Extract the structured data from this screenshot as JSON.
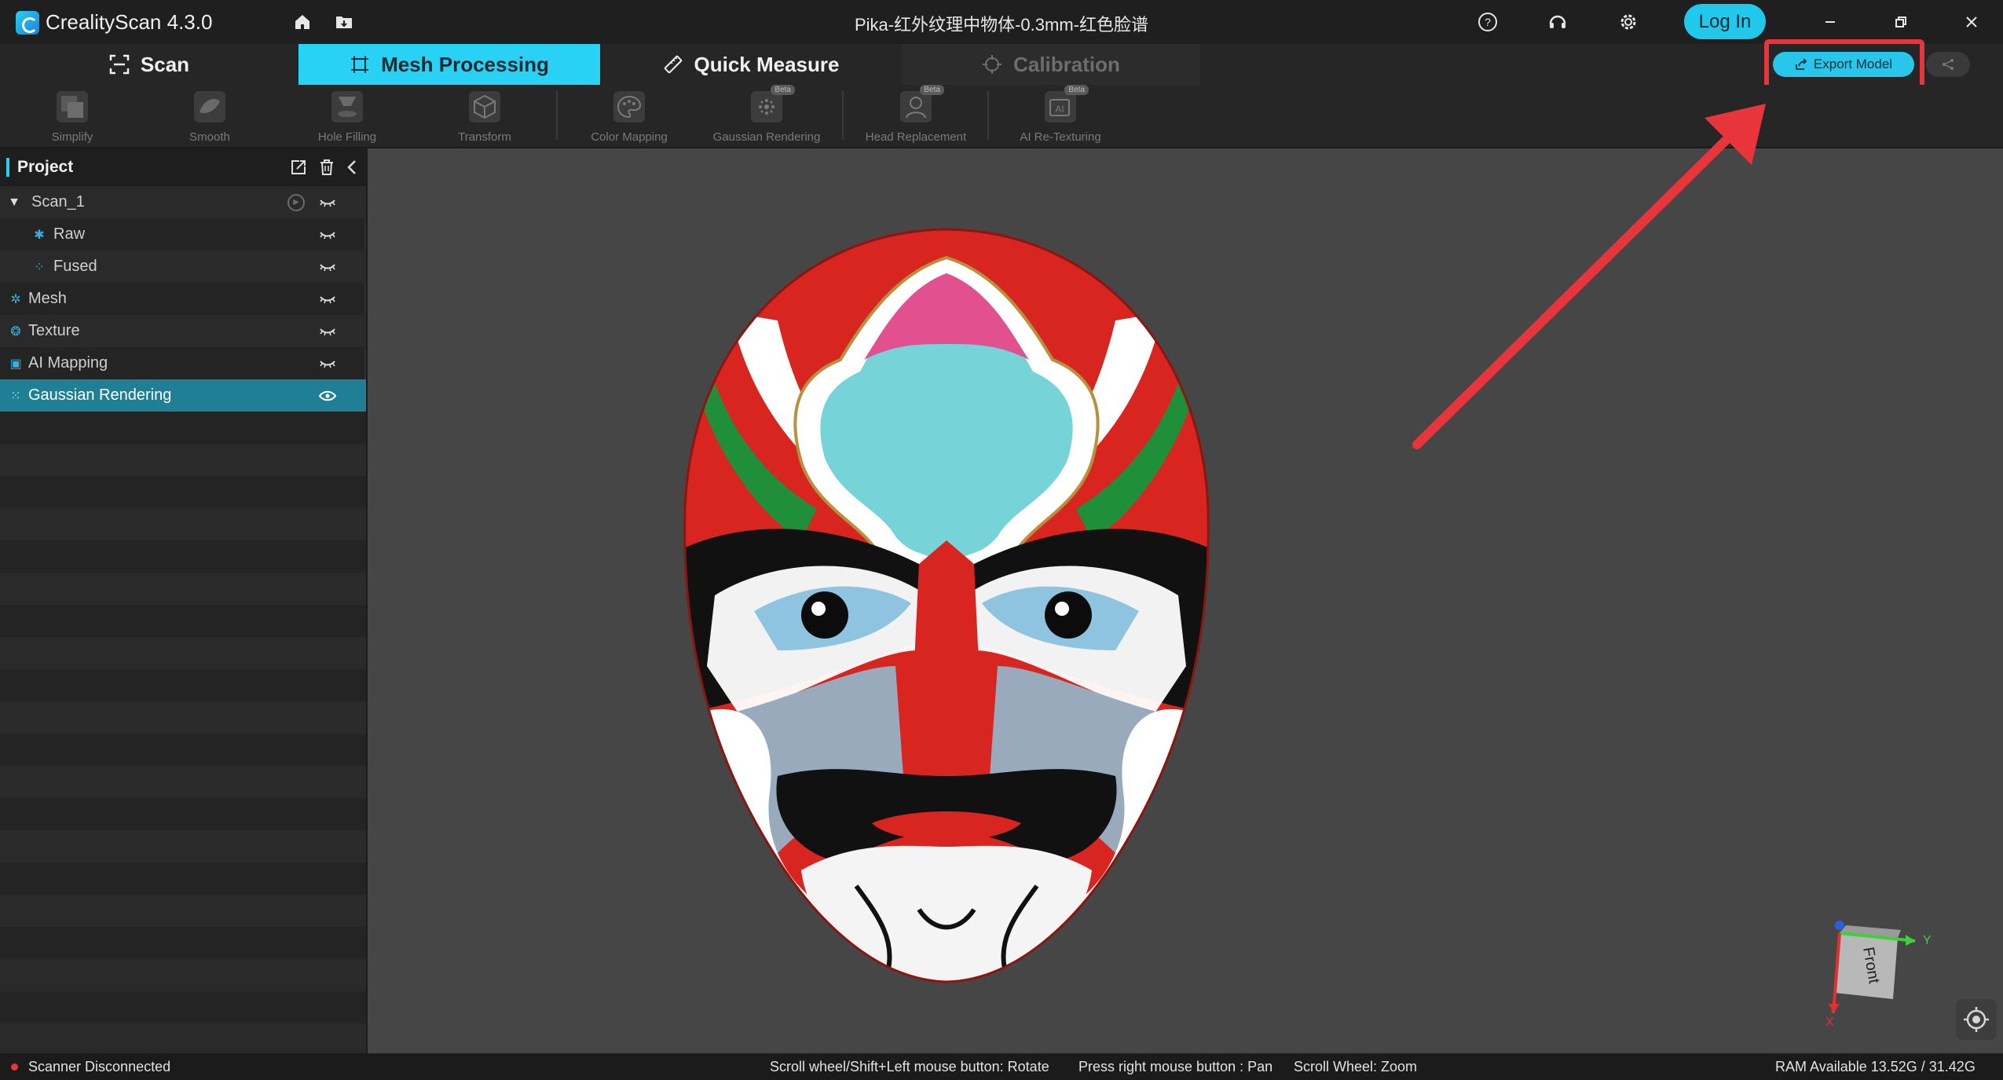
{
  "app": {
    "name": "CrealityScan 4.3.0",
    "document_title": "Pika-红外纹理中物体-0.3mm-红色脸谱"
  },
  "titlebar": {
    "login_label": "Log In",
    "icons": [
      "home-icon",
      "folder-icon",
      "help-icon",
      "support-headset-icon",
      "settings-icon",
      "minimize-icon",
      "restore-icon",
      "close-icon"
    ]
  },
  "modes": [
    {
      "label": "Scan",
      "icon": "scan-icon",
      "state": "normal"
    },
    {
      "label": "Mesh Processing",
      "icon": "mesh-processing-icon",
      "state": "active"
    },
    {
      "label": "Quick Measure",
      "icon": "ruler-icon",
      "state": "normal"
    },
    {
      "label": "Calibration",
      "icon": "crosshair-icon",
      "state": "disabled"
    }
  ],
  "export": {
    "label": "Export Model",
    "icon": "export-icon",
    "accent": "#27c6ea"
  },
  "tools": [
    {
      "label": "Simplify",
      "icon": "simplify-icon",
      "beta": false
    },
    {
      "label": "Smooth",
      "icon": "smooth-icon",
      "beta": false
    },
    {
      "label": "Hole Filling",
      "icon": "hole-filling-icon",
      "beta": false
    },
    {
      "label": "Transform",
      "icon": "transform-icon",
      "beta": false
    },
    {
      "label": "Color Mapping",
      "icon": "palette-icon",
      "beta": false
    },
    {
      "label": "Gaussian Rendering",
      "icon": "gaussian-icon",
      "beta": true
    },
    {
      "label": "Head Replacement",
      "icon": "head-replacement-icon",
      "beta": true
    },
    {
      "label": "AI Re-Texturing",
      "icon": "ai-retexture-icon",
      "beta": true
    }
  ],
  "beta_label": "Beta",
  "project": {
    "title": "Project",
    "items": [
      {
        "label": "Scan_1",
        "icon": "caret-down-icon",
        "level": 0
      },
      {
        "label": "Raw",
        "icon": "raw-points-icon",
        "level": 1
      },
      {
        "label": "Fused",
        "icon": "fused-points-icon",
        "level": 1
      },
      {
        "label": "Mesh",
        "icon": "mesh-icon",
        "level": 0
      },
      {
        "label": "Texture",
        "icon": "texture-icon",
        "level": 0
      },
      {
        "label": "AI Mapping",
        "icon": "ai-mapping-icon",
        "level": 0
      },
      {
        "label": "Gaussian Rendering",
        "icon": "gaussian-icon",
        "level": 0,
        "selected": true
      }
    ]
  },
  "gizmo": {
    "face_label": "Front",
    "y_label": "Y",
    "x_label": "X"
  },
  "status": {
    "scanner": "Scanner Disconnected",
    "hint_rotate": "Scroll wheel/Shift+Left mouse button: Rotate",
    "hint_pan": "Press right mouse button : Pan",
    "hint_zoom": "Scroll Wheel: Zoom",
    "ram": "RAM Available 13.52G / 31.42G"
  },
  "colors": {
    "accent": "#29d2f4",
    "selected_row": "#1f7f95",
    "annotation": "#e8353c",
    "status_error": "#e03b3b"
  }
}
